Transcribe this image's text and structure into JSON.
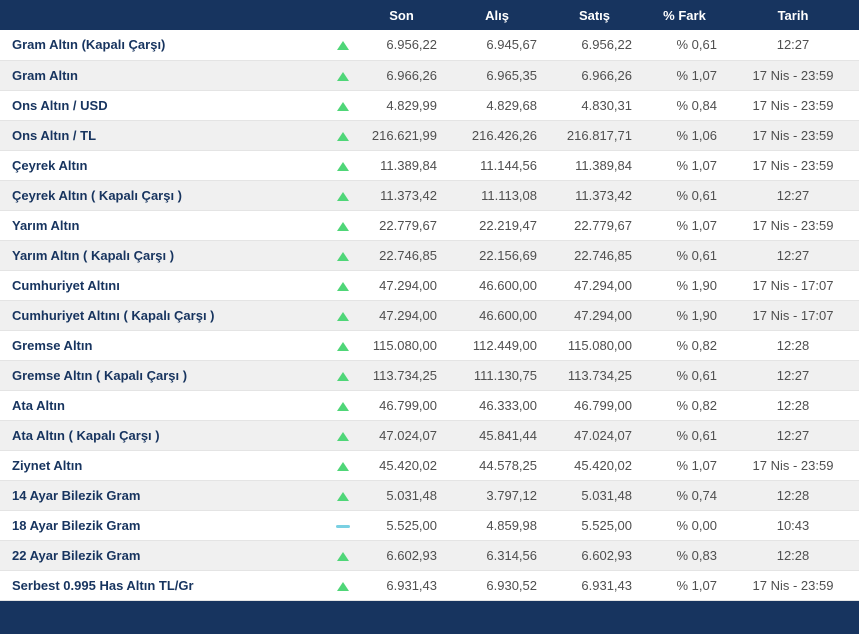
{
  "colors": {
    "header_bg": "#17345f",
    "name_color": "#17345f",
    "value_color": "#4f4f4f",
    "row_alt_bg": "#f0f0f0",
    "row_border": "#e4e4e4",
    "up_color": "#4fd678",
    "flat_color": "#7ad0e2"
  },
  "table": {
    "headers": {
      "son": "Son",
      "alis": "Alış",
      "satis": "Satış",
      "fark": "% Fark",
      "tarih": "Tarih"
    },
    "rows": [
      {
        "name": "Gram Altın (Kapalı Çarşı)",
        "trend": "up",
        "son": "6.956,22",
        "alis": "6.945,67",
        "satis": "6.956,22",
        "fark": "% 0,61",
        "tarih": "12:27"
      },
      {
        "name": "Gram Altın",
        "trend": "up",
        "son": "6.966,26",
        "alis": "6.965,35",
        "satis": "6.966,26",
        "fark": "% 1,07",
        "tarih": "17 Nis - 23:59"
      },
      {
        "name": "Ons Altın / USD",
        "trend": "up",
        "son": "4.829,99",
        "alis": "4.829,68",
        "satis": "4.830,31",
        "fark": "% 0,84",
        "tarih": "17 Nis - 23:59"
      },
      {
        "name": "Ons Altın / TL",
        "trend": "up",
        "son": "216.621,99",
        "alis": "216.426,26",
        "satis": "216.817,71",
        "fark": "% 1,06",
        "tarih": "17 Nis - 23:59"
      },
      {
        "name": "Çeyrek Altın",
        "trend": "up",
        "son": "11.389,84",
        "alis": "11.144,56",
        "satis": "11.389,84",
        "fark": "% 1,07",
        "tarih": "17 Nis - 23:59"
      },
      {
        "name": "Çeyrek Altın ( Kapalı Çarşı )",
        "trend": "up",
        "son": "11.373,42",
        "alis": "11.113,08",
        "satis": "11.373,42",
        "fark": "% 0,61",
        "tarih": "12:27"
      },
      {
        "name": "Yarım Altın",
        "trend": "up",
        "son": "22.779,67",
        "alis": "22.219,47",
        "satis": "22.779,67",
        "fark": "% 1,07",
        "tarih": "17 Nis - 23:59"
      },
      {
        "name": "Yarım Altın ( Kapalı Çarşı )",
        "trend": "up",
        "son": "22.746,85",
        "alis": "22.156,69",
        "satis": "22.746,85",
        "fark": "% 0,61",
        "tarih": "12:27"
      },
      {
        "name": "Cumhuriyet Altını",
        "trend": "up",
        "son": "47.294,00",
        "alis": "46.600,00",
        "satis": "47.294,00",
        "fark": "% 1,90",
        "tarih": "17 Nis - 17:07"
      },
      {
        "name": "Cumhuriyet Altını ( Kapalı Çarşı )",
        "trend": "up",
        "son": "47.294,00",
        "alis": "46.600,00",
        "satis": "47.294,00",
        "fark": "% 1,90",
        "tarih": "17 Nis - 17:07"
      },
      {
        "name": "Gremse Altın",
        "trend": "up",
        "son": "115.080,00",
        "alis": "112.449,00",
        "satis": "115.080,00",
        "fark": "% 0,82",
        "tarih": "12:28"
      },
      {
        "name": "Gremse Altın ( Kapalı Çarşı )",
        "trend": "up",
        "son": "113.734,25",
        "alis": "111.130,75",
        "satis": "113.734,25",
        "fark": "% 0,61",
        "tarih": "12:27"
      },
      {
        "name": "Ata Altın",
        "trend": "up",
        "son": "46.799,00",
        "alis": "46.333,00",
        "satis": "46.799,00",
        "fark": "% 0,82",
        "tarih": "12:28"
      },
      {
        "name": "Ata Altın ( Kapalı Çarşı )",
        "trend": "up",
        "son": "47.024,07",
        "alis": "45.841,44",
        "satis": "47.024,07",
        "fark": "% 0,61",
        "tarih": "12:27"
      },
      {
        "name": "Ziynet Altın",
        "trend": "up",
        "son": "45.420,02",
        "alis": "44.578,25",
        "satis": "45.420,02",
        "fark": "% 1,07",
        "tarih": "17 Nis - 23:59"
      },
      {
        "name": "14 Ayar Bilezik Gram",
        "trend": "up",
        "son": "5.031,48",
        "alis": "3.797,12",
        "satis": "5.031,48",
        "fark": "% 0,74",
        "tarih": "12:28"
      },
      {
        "name": "18 Ayar Bilezik Gram",
        "trend": "flat",
        "son": "5.525,00",
        "alis": "4.859,98",
        "satis": "5.525,00",
        "fark": "% 0,00",
        "tarih": "10:43"
      },
      {
        "name": "22 Ayar Bilezik Gram",
        "trend": "up",
        "son": "6.602,93",
        "alis": "6.314,56",
        "satis": "6.602,93",
        "fark": "% 0,83",
        "tarih": "12:28"
      },
      {
        "name": "Serbest 0.995 Has Altın TL/Gr",
        "trend": "up",
        "son": "6.931,43",
        "alis": "6.930,52",
        "satis": "6.931,43",
        "fark": "% 1,07",
        "tarih": "17 Nis - 23:59"
      }
    ]
  }
}
